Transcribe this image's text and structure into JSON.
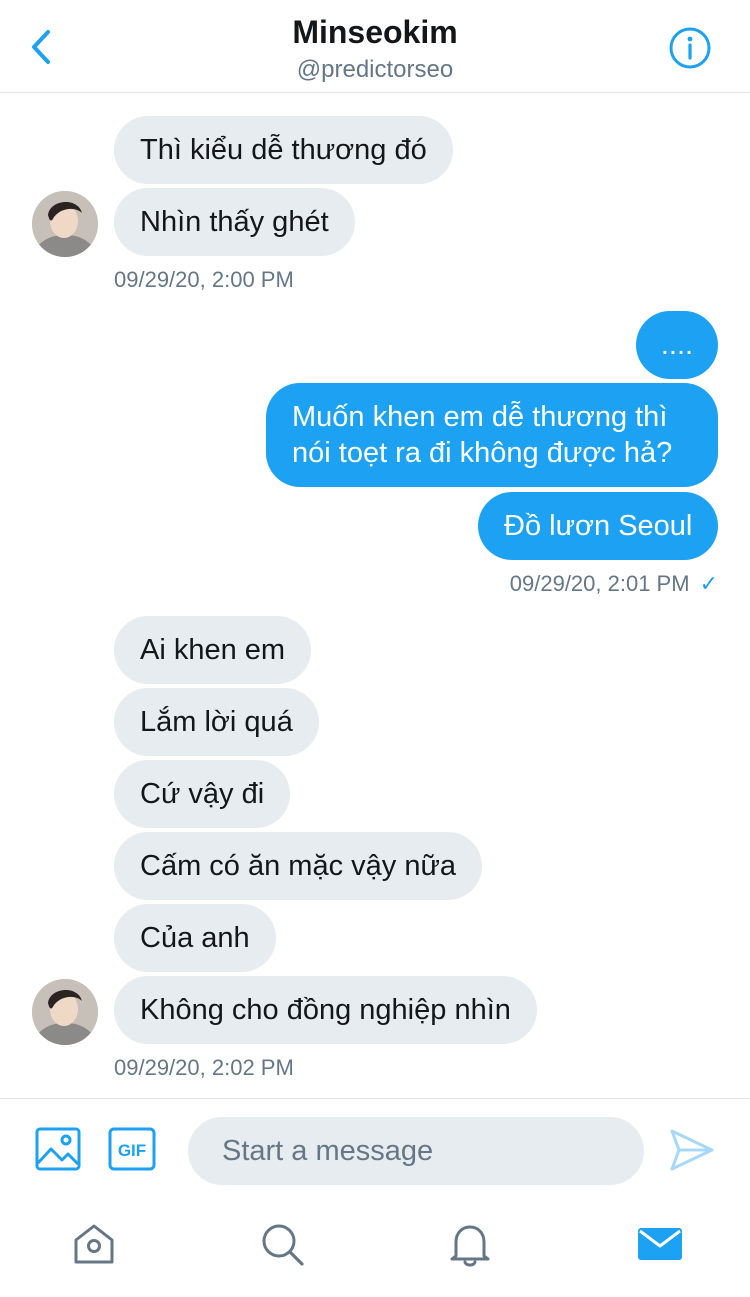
{
  "header": {
    "name": "Minseokim",
    "handle": "@predictorseo"
  },
  "messages": {
    "group1": [
      "Thì kiểu dễ thương đó",
      "Nhìn thấy ghét"
    ],
    "group1_time": "09/29/20, 2:00 PM",
    "group2": [
      "....",
      "Muốn khen em dễ thương thì nói toẹt ra đi không được hả?",
      "Đồ lươn Seoul"
    ],
    "group2_time": "09/29/20, 2:01 PM",
    "group2_status": "✓",
    "group3": [
      "Ai khen em",
      "Lắm lời quá",
      "Cứ vậy đi",
      "Cấm có ăn mặc vậy nữa",
      "Của anh",
      "Không cho đồng nghiệp nhìn"
    ],
    "group3_time": "09/29/20, 2:02 PM"
  },
  "composer": {
    "placeholder": "Start a message",
    "gif_label": "GIF"
  },
  "nav": {
    "items": [
      "home-icon",
      "search-icon",
      "notifications-icon",
      "messages-icon"
    ],
    "active": "messages-icon"
  },
  "colors": {
    "accent": "#1da1f2",
    "received_bubble": "#e6ecf0",
    "secondary_text": "#657786"
  }
}
